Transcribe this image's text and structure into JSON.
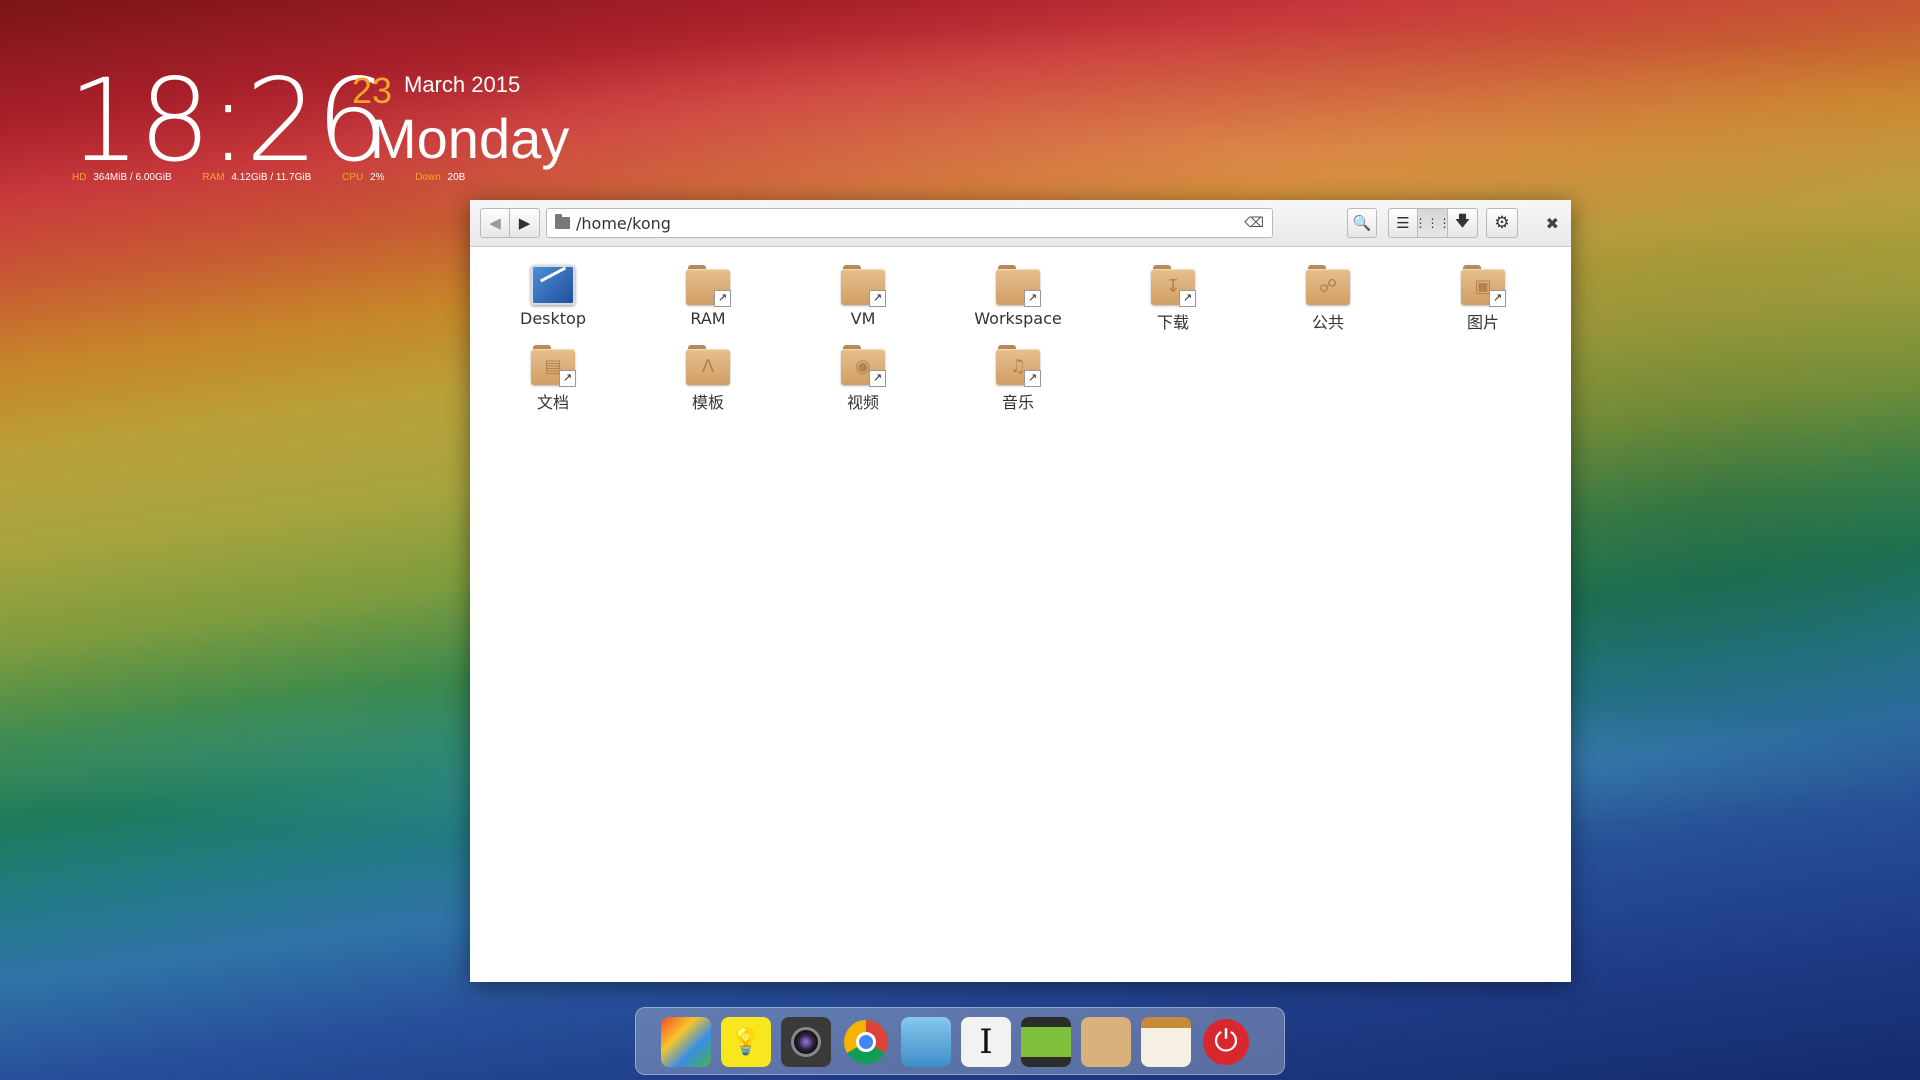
{
  "widget": {
    "clock": "18:26",
    "day": "23",
    "month_year": "March 2015",
    "weekday": "Monday",
    "stats": [
      {
        "key": "HD",
        "value": "364MiB  / 6.00GiB"
      },
      {
        "key": "RAM",
        "value": "4.12GiB / 11.7GiB"
      },
      {
        "key": "CPU",
        "value": "2%"
      },
      {
        "key": "Down",
        "value": "20B"
      }
    ]
  },
  "filemanager": {
    "path": "/home/kong",
    "items": [
      {
        "label": "Desktop",
        "icon": "desktop-icon"
      },
      {
        "label": "RAM",
        "icon": "folder-link-icon"
      },
      {
        "label": "VM",
        "icon": "folder-link-icon"
      },
      {
        "label": "Workspace",
        "icon": "folder-link-icon"
      },
      {
        "label": "下载",
        "icon": "download-folder-icon"
      },
      {
        "label": "公共",
        "icon": "share-folder-icon"
      },
      {
        "label": "图片",
        "icon": "pictures-folder-icon"
      },
      {
        "label": "文档",
        "icon": "documents-folder-icon"
      },
      {
        "label": "模板",
        "icon": "templates-folder-icon"
      },
      {
        "label": "视频",
        "icon": "videos-folder-icon"
      },
      {
        "label": "音乐",
        "icon": "music-folder-icon"
      }
    ]
  },
  "dock": [
    {
      "name": "app-grid-icon"
    },
    {
      "name": "lightbulb-icon"
    },
    {
      "name": "camera-icon"
    },
    {
      "name": "chrome-icon"
    },
    {
      "name": "files-icon"
    },
    {
      "name": "text-editor-icon"
    },
    {
      "name": "video-icon"
    },
    {
      "name": "archive-icon"
    },
    {
      "name": "notes-icon"
    },
    {
      "name": "power-icon"
    }
  ],
  "colors": {
    "accent": "#f3a32c",
    "folder": "#d9a96e"
  }
}
